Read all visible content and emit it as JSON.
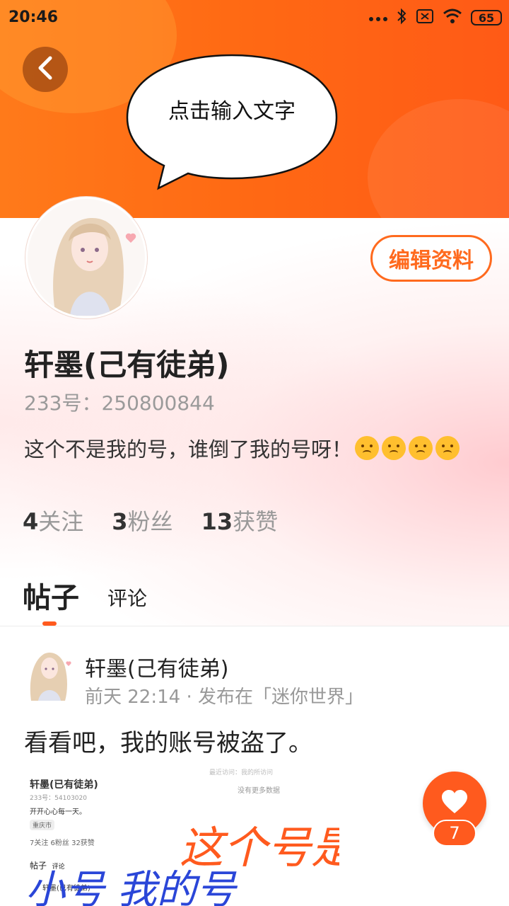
{
  "status_bar": {
    "time": "20:46",
    "battery": "65"
  },
  "speech_bubble": {
    "text": "点击输入文字"
  },
  "profile": {
    "edit_label": "编辑资料",
    "name": "轩墨(己有徒弟)",
    "id_line": "233号：250800844",
    "bio": "这个不是我的号，谁倒了我的号呀！",
    "stats": [
      {
        "value": "4",
        "label": "关注"
      },
      {
        "value": "3",
        "label": "粉丝"
      },
      {
        "value": "13",
        "label": "获赞"
      }
    ]
  },
  "tabs": {
    "posts": "帖子",
    "comments": "评论"
  },
  "post": {
    "author": "轩墨(己有徒弟)",
    "meta": "前天 22:14 · 发布在「迷你世界」",
    "text": "看看吧，我的账号被盗了。",
    "image": {
      "name": "轩墨(已有徒弟)",
      "id_line": "233号：54103020",
      "bio": "开开心心每一天。",
      "location": "重庆市",
      "stats": "7关注   6粉丝   32获赞",
      "tab_posts": "帖子",
      "tab_comments": "评论",
      "author": "轩墨(已有徒弟)",
      "top_text": "最近访问：我的所访问",
      "no_data": "没有更多数据",
      "handwriting_line1": "这个号是",
      "handwriting_line2": "小号 我的号"
    },
    "like_count": "7"
  },
  "colors": {
    "accent": "#ff6a1e",
    "header": "#ff6a14",
    "handwriting": "#2a46d8",
    "handwriting_alt": "#ff5a1e"
  }
}
